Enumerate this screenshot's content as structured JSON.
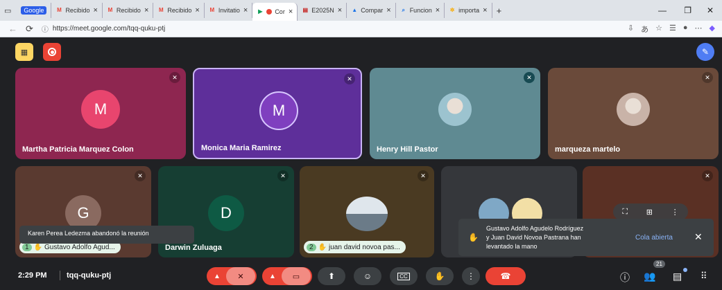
{
  "browser": {
    "tabs": [
      {
        "label": "Google",
        "icon": "google",
        "active": false
      },
      {
        "label": "Recibido",
        "icon": "gmail",
        "active": false
      },
      {
        "label": "Recibido",
        "icon": "gmail",
        "active": false
      },
      {
        "label": "Recibido",
        "icon": "gmail",
        "active": false
      },
      {
        "label": "Invitatio",
        "icon": "gmail",
        "active": false
      },
      {
        "label": "Cor",
        "icon": "meet",
        "active": true
      },
      {
        "label": "E2025N",
        "icon": "doc",
        "active": false
      },
      {
        "label": "Compar",
        "icon": "drive",
        "active": false
      },
      {
        "label": "Funcion",
        "icon": "search",
        "active": false
      },
      {
        "label": "importa",
        "icon": "star",
        "active": false
      }
    ],
    "new_tab": "+",
    "url": "https://meet.google.com/tqq-quku-ptj"
  },
  "participants_top": [
    {
      "name": "Martha Patricia Marquez Colon",
      "initial": "M",
      "bg": "#8e2650",
      "avatar_color": "#e8456e",
      "type": "initial"
    },
    {
      "name": "Monica Maria Ramirez",
      "initial": "M",
      "bg": "#5e2f9a",
      "avatar_color": "#7f3fbf",
      "type": "initial"
    },
    {
      "name": "Henry Hill Pastor",
      "initial": "",
      "bg": "#5f8a92",
      "avatar_color": "#9cc3cf",
      "type": "photo"
    },
    {
      "name": "marqueza martelo",
      "initial": "",
      "bg": "#6a4a3a",
      "avatar_color": "#c9b3a8",
      "type": "photo"
    }
  ],
  "participants_bottom": [
    {
      "name": "Gustavo Adolfo Agud...",
      "initial": "G",
      "bg": "#5a3a30",
      "avatar_color": "#8a6a60",
      "badge": "1"
    },
    {
      "name": "Darwin Zuluaga",
      "initial": "D",
      "bg": "#163e33",
      "avatar_color": "#0e5a44",
      "badge": ""
    },
    {
      "name": "juan david novoa pas...",
      "initial": "",
      "bg": "#4a3a22",
      "avatar_color": "#a9b9c9",
      "badge": "2"
    },
    {
      "name": "",
      "initial": "",
      "bg": "#35373b",
      "avatar_color": "#5a6a7a",
      "badge": ""
    },
    {
      "name": "",
      "initial": "",
      "bg": "#5a3024",
      "avatar_color": "#7a4a3a",
      "badge": ""
    }
  ],
  "notifications": {
    "left": "Karen Perea Ledezma abandonó la reunión",
    "hands_text_1": "Gustavo Adolfo Agudelo Rodríguez",
    "hands_text_2": "y Juan David Novoa Pastrana han",
    "hands_text_3": "levantado la mano",
    "hands_action": "Cola abierta"
  },
  "bottom_bar": {
    "time": "2:29 PM",
    "meeting_code": "tqq-quku-ptj",
    "participant_count": "21"
  },
  "colors": {
    "accent": "#8ab4f8",
    "end_call": "#ea4335",
    "mute_bg": "#ea4335"
  }
}
